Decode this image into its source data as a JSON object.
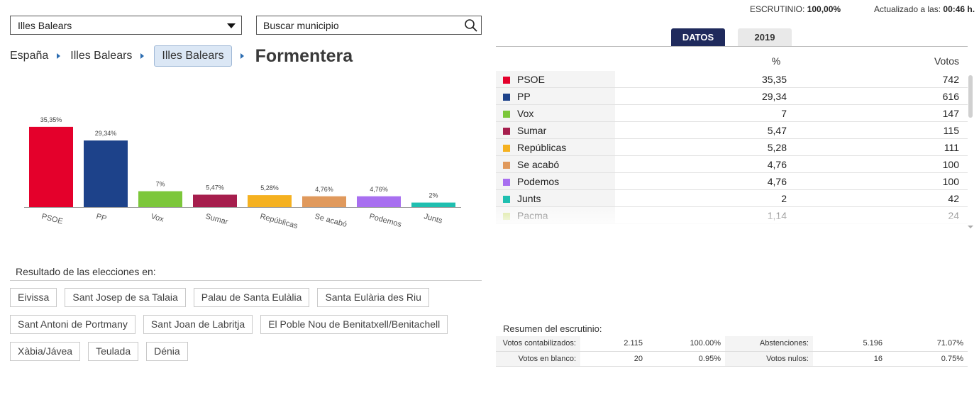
{
  "selector": {
    "value": "Illes Balears"
  },
  "search": {
    "placeholder": "Buscar municipio"
  },
  "breadcrumb": {
    "items": [
      "España",
      "Illes Balears"
    ],
    "active": "Illes Balears",
    "current": "Formentera"
  },
  "header": {
    "escrutinio_label": "ESCRUTINIO:",
    "escrutinio_value": "100,00%",
    "updated_label": "Actualizado a las:",
    "updated_value": "00:46 h."
  },
  "tabs": [
    {
      "label": "DATOS",
      "active": true
    },
    {
      "label": "2019",
      "active": false
    }
  ],
  "table": {
    "col_pct": "%",
    "col_votes": "Votos",
    "rows": [
      {
        "name": "PSOE",
        "pct": "35,35",
        "votes": "742",
        "color": "#e4002b"
      },
      {
        "name": "PP",
        "pct": "29,34",
        "votes": "616",
        "color": "#1d428a"
      },
      {
        "name": "Vox",
        "pct": "7",
        "votes": "147",
        "color": "#7cc73a"
      },
      {
        "name": "Sumar",
        "pct": "5,47",
        "votes": "115",
        "color": "#a61e4d"
      },
      {
        "name": "Repúblicas",
        "pct": "5,28",
        "votes": "111",
        "color": "#f5b120"
      },
      {
        "name": "Se acabó",
        "pct": "4,76",
        "votes": "100",
        "color": "#e0995c"
      },
      {
        "name": "Podemos",
        "pct": "4,76",
        "votes": "100",
        "color": "#a86ff0"
      },
      {
        "name": "Junts",
        "pct": "2",
        "votes": "42",
        "color": "#1fbfb0"
      },
      {
        "name": "Pacma",
        "pct": "1,14",
        "votes": "24",
        "color": "#c8d96a"
      }
    ]
  },
  "chart_data": {
    "type": "bar",
    "categories": [
      "PSOE",
      "PP",
      "Vox",
      "Sumar",
      "Repúblicas",
      "Se acabó",
      "Podemos",
      "Junts"
    ],
    "values": [
      35.35,
      29.34,
      7,
      5.47,
      5.28,
      4.76,
      4.76,
      2
    ],
    "labels": [
      "35,35%",
      "29,34%",
      "7%",
      "5,47%",
      "5,28%",
      "4,76%",
      "4,76%",
      "2%"
    ],
    "colors": [
      "#e4002b",
      "#1d428a",
      "#7cc73a",
      "#a61e4d",
      "#f5b120",
      "#e0995c",
      "#a86ff0",
      "#1fbfb0"
    ],
    "ylim": [
      0,
      40
    ],
    "grid": false
  },
  "results": {
    "title": "Resultado de las elecciones en:",
    "municipalities": [
      "Eivissa",
      "Sant Josep de sa Talaia",
      "Palau de Santa Eulàlia",
      "Santa Eulària des Riu",
      "Sant Antoni de Portmany",
      "Sant Joan de Labritja",
      "El Poble Nou de Benitatxell/Benitachell",
      "Xàbia/Jávea",
      "Teulada",
      "Dénia"
    ]
  },
  "summary": {
    "title": "Resumen del escrutinio:",
    "rows": [
      [
        "Votos contabilizados:",
        "2.115",
        "100.00%",
        "Abstenciones:",
        "5.196",
        "71.07%"
      ],
      [
        "Votos en blanco:",
        "20",
        "0.95%",
        "Votos nulos:",
        "16",
        "0.75%"
      ]
    ]
  }
}
